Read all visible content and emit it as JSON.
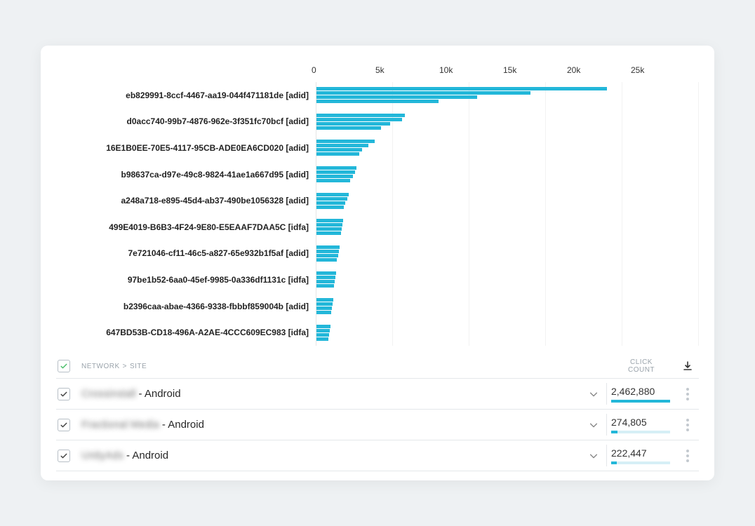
{
  "chart_data": {
    "type": "bar",
    "orientation": "horizontal",
    "xlabel": "",
    "ylabel": "",
    "xlim": [
      0,
      25000
    ],
    "x_ticks": [
      "0",
      "5k",
      "10k",
      "15k",
      "20k",
      "25k"
    ],
    "label_categories": [
      "eb829991-8ccf-4467-aa19-044f471181de [adid]",
      "d0acc740-99b7-4876-962e-3f351fc70bcf [adid]",
      "16E1B0EE-70E5-4117-95CB-ADE0EA6CD020 [adid]",
      "b98637ca-d97e-49c8-9824-41ae1a667d95 [adid]",
      "a248a718-e895-45d4-ab37-490be1056328 [adid]",
      "499E4019-B6B3-4F24-9E80-E5EAAF7DAA5C [idfa]",
      "7e721046-cf11-46c5-a827-65e932b1f5af [adid]",
      "97be1b52-6aa0-45ef-9985-0a336df1131c [idfa]",
      "b2396caa-abae-4366-9338-fbbbf859004b [adid]",
      "647BD53B-CD18-496A-A2AE-4CCC609EC983 [idfa]"
    ],
    "series_groups": [
      [
        19000,
        14000,
        10500,
        8000
      ],
      [
        5800,
        5600,
        4800,
        4200
      ],
      [
        3800,
        3400,
        3000,
        2800
      ],
      [
        2600,
        2500,
        2400,
        2200
      ],
      [
        2100,
        2000,
        1900,
        1800
      ],
      [
        1750,
        1700,
        1650,
        1600
      ],
      [
        1500,
        1450,
        1400,
        1350
      ],
      [
        1300,
        1250,
        1200,
        1150
      ],
      [
        1100,
        1050,
        1000,
        950
      ],
      [
        900,
        850,
        820,
        800
      ]
    ]
  },
  "table": {
    "breadcrumb_a": "NETWORK",
    "breadcrumb_sep": ">",
    "breadcrumb_b": "SITE",
    "click_label_l1": "CLICK",
    "click_label_l2": "COUNT",
    "header_checked": true,
    "max_clicks": 2462880,
    "rows": [
      {
        "checked": true,
        "name_hidden": "Crossinstall",
        "suffix": " - Android",
        "clicks": "2,462,880",
        "clicks_num": 2462880
      },
      {
        "checked": true,
        "name_hidden": "Fractional Media",
        "suffix": " - Android",
        "clicks": "274,805",
        "clicks_num": 274805
      },
      {
        "checked": true,
        "name_hidden": "UnityAds",
        "suffix": " - Android",
        "clicks": "222,447",
        "clicks_num": 222447
      }
    ]
  }
}
